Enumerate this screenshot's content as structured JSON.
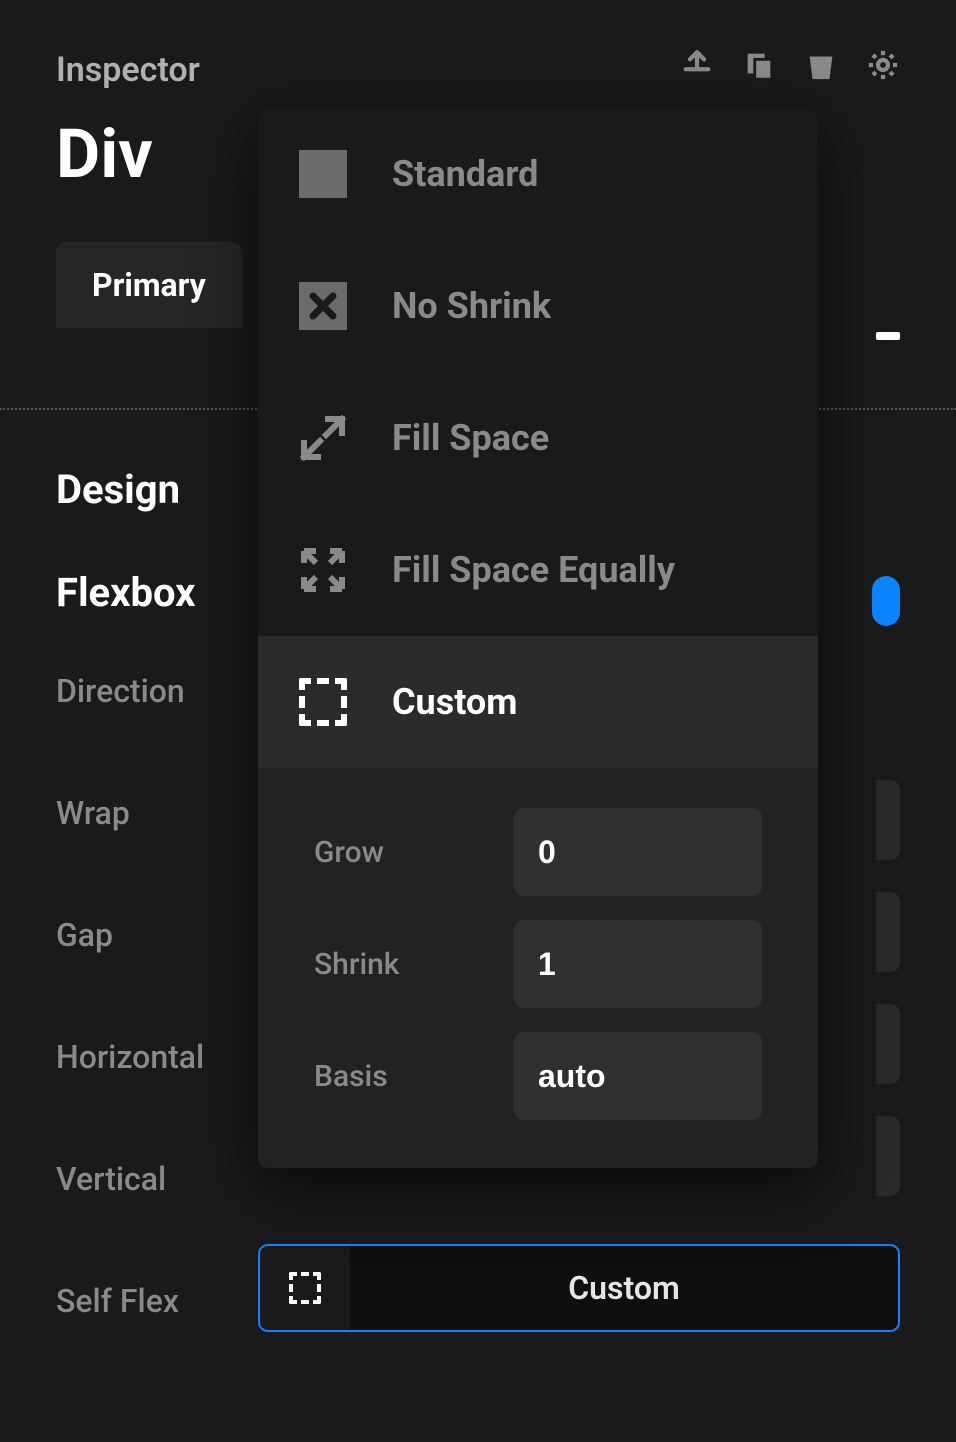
{
  "inspector": {
    "title": "Inspector",
    "element_name": "Div"
  },
  "tabs": {
    "primary": "Primary"
  },
  "design": {
    "heading": "Design",
    "flexbox_heading": "Flexbox",
    "labels": {
      "direction": "Direction",
      "wrap": "Wrap",
      "gap": "Gap",
      "horizontal": "Horizontal",
      "vertical": "Vertical",
      "self_flex": "Self Flex"
    }
  },
  "self_flex_button": {
    "label": "Custom",
    "icon": "dashed-square-icon"
  },
  "dropdown": {
    "options": [
      {
        "label": "Standard",
        "icon": "square-icon"
      },
      {
        "label": "No Shrink",
        "icon": "box-x-icon"
      },
      {
        "label": "Fill Space",
        "icon": "expand-diagonal-icon"
      },
      {
        "label": "Fill Space Equally",
        "icon": "expand-all-icon"
      },
      {
        "label": "Custom",
        "icon": "dashed-square-icon",
        "selected": true
      }
    ],
    "custom_fields": {
      "grow_label": "Grow",
      "grow_value": "0",
      "shrink_label": "Shrink",
      "shrink_value": "1",
      "basis_label": "Basis",
      "basis_value": "auto"
    }
  },
  "toolbar_icons": [
    "upload-icon",
    "copy-icon",
    "trash-icon",
    "gear-icon"
  ]
}
